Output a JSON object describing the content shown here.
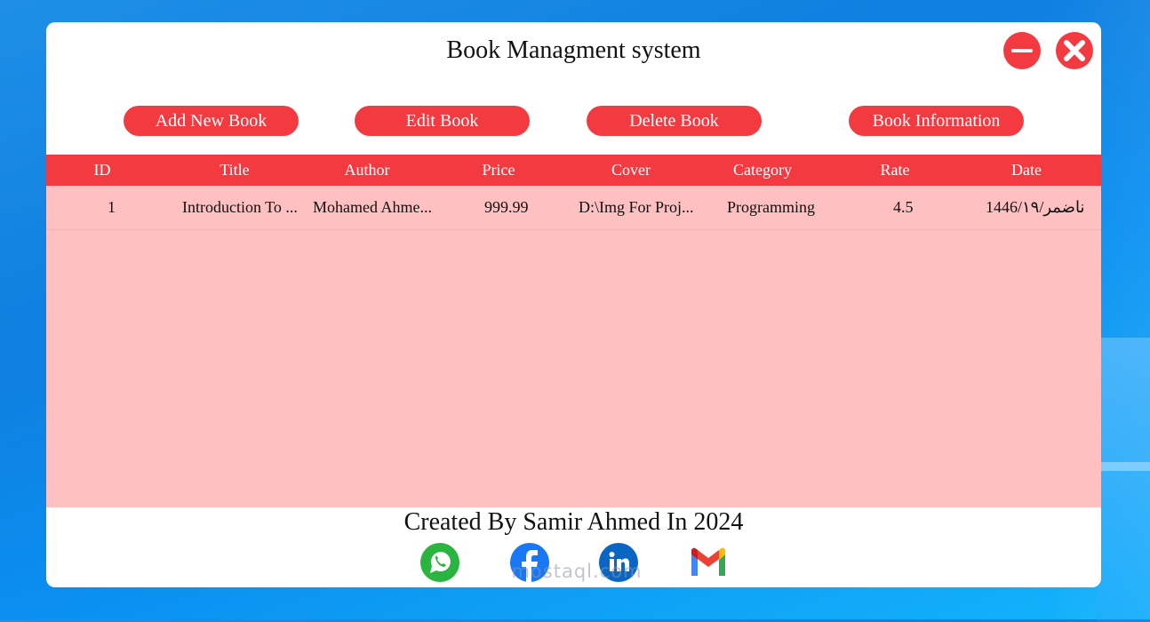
{
  "window": {
    "title": "Book Managment system"
  },
  "toolbar": {
    "add_label": "Add New Book",
    "edit_label": "Edit Book",
    "delete_label": "Delete Book",
    "info_label": "Book Information"
  },
  "table": {
    "columns": [
      "ID",
      "Title",
      "Author",
      "Price",
      "Cover",
      "Category",
      "Rate",
      "Date"
    ],
    "rows": [
      [
        "1",
        "Introduction To ...",
        "Mohamed Ahme...",
        "999.99",
        "D:\\Img For Proj...",
        "Programming",
        "4.5",
        "1446/١٩/رمضان"
      ]
    ]
  },
  "footer": {
    "credit": "Created By Samir Ahmed In 2024",
    "watermark": "mostaql.com"
  },
  "icons": {
    "minimize": "minimize-icon",
    "close": "close-icon",
    "whatsapp": "whatsapp-icon",
    "facebook": "facebook-icon",
    "linkedin": "linkedin-icon",
    "gmail": "gmail-icon"
  },
  "colors": {
    "accent": "#f33a41",
    "grid_background": "#fec0c0",
    "desktop": "#0f7fe0"
  }
}
